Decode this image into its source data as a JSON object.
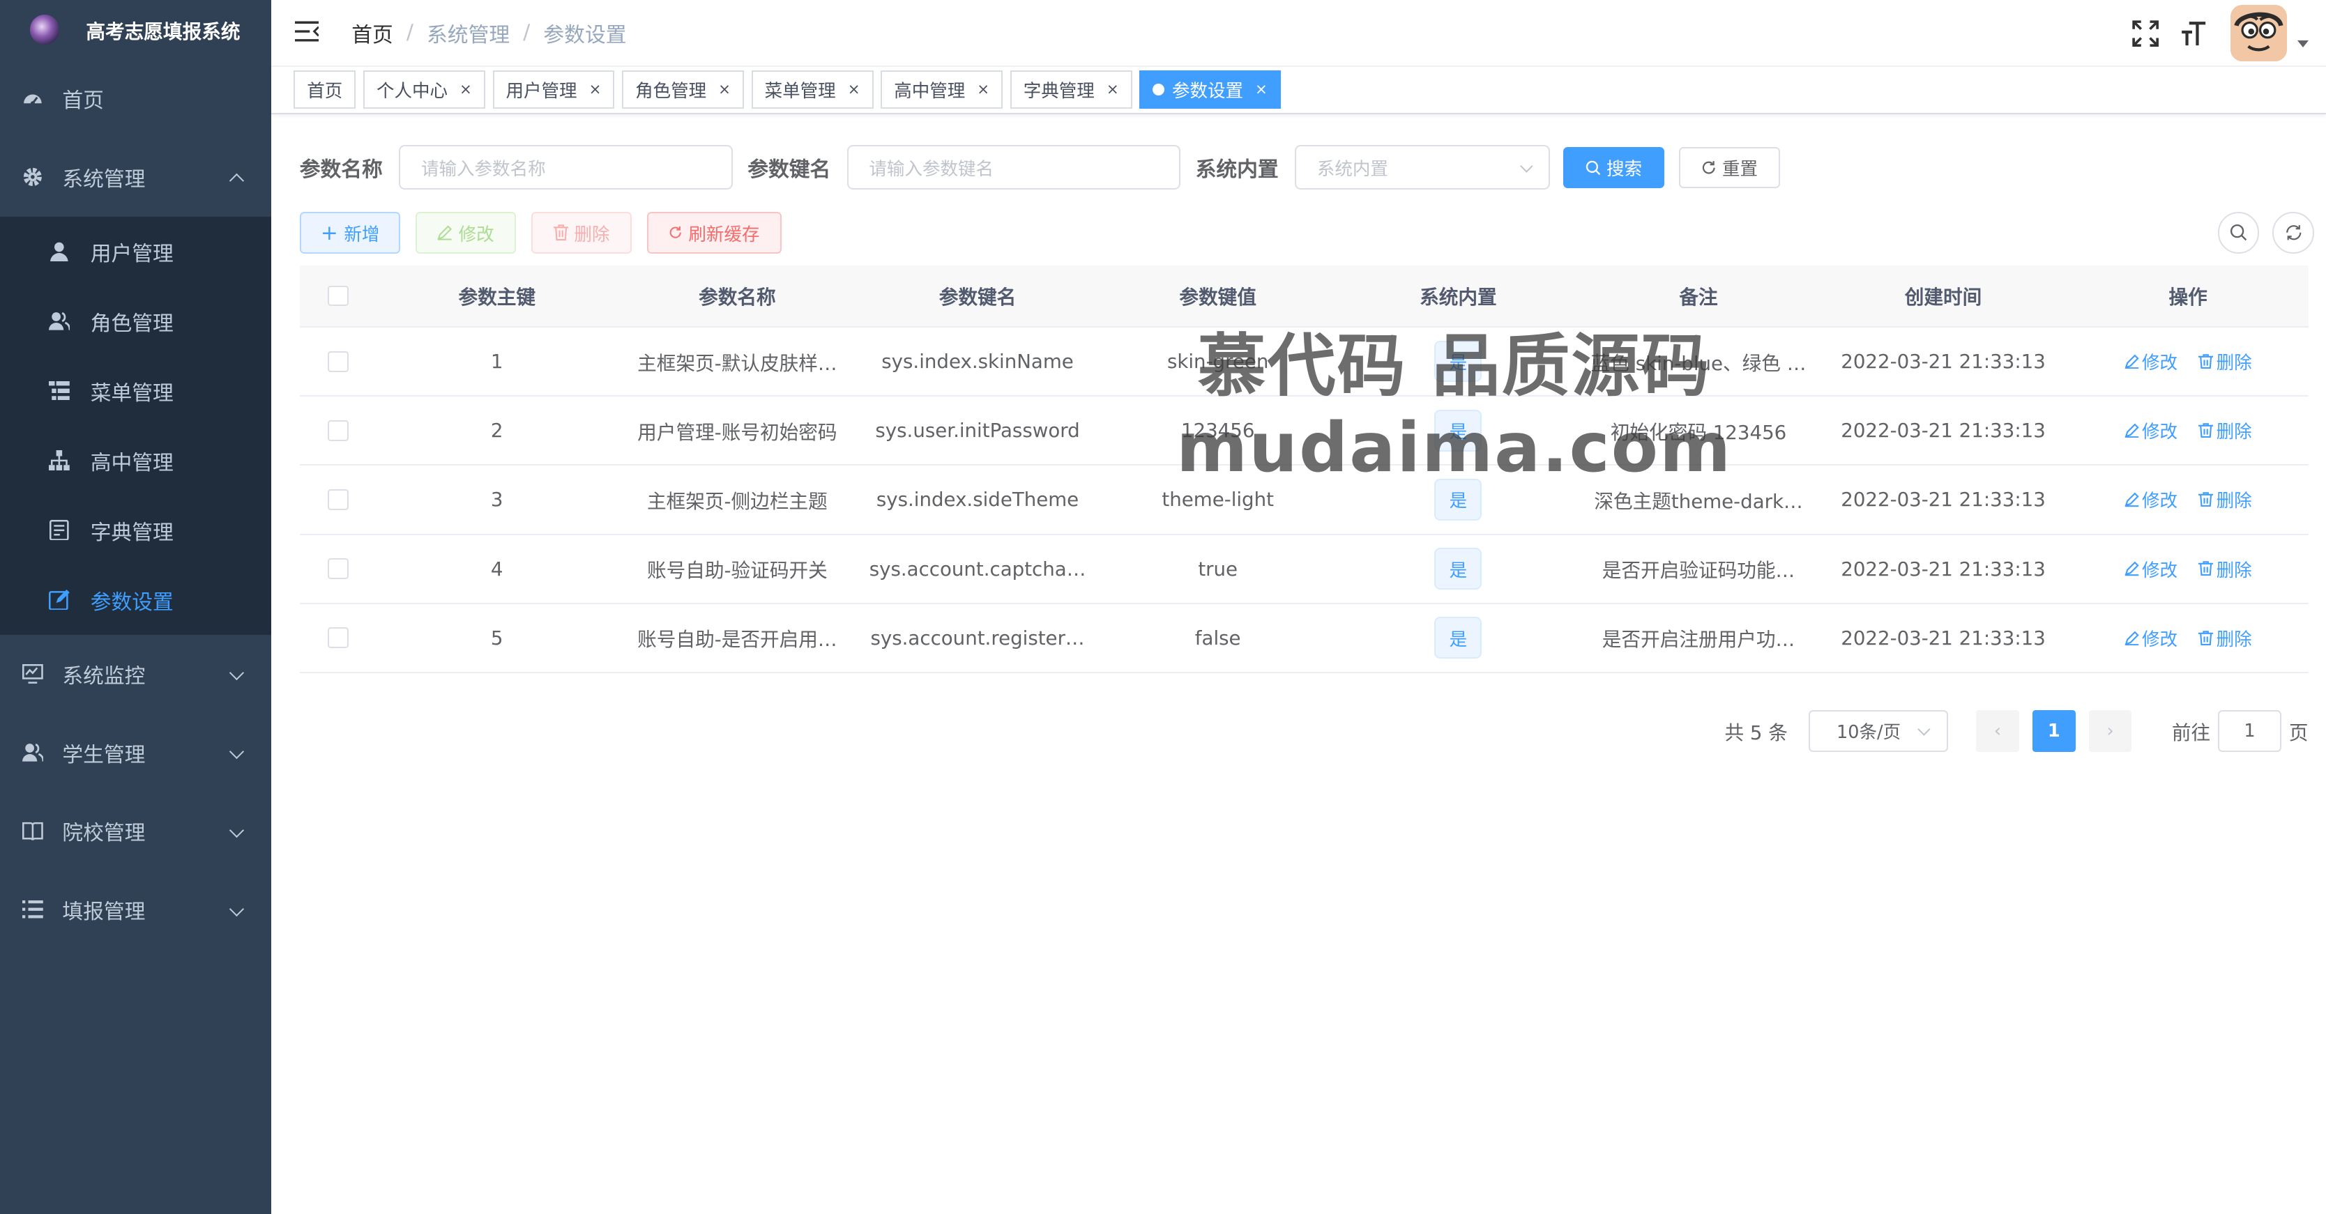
{
  "app": {
    "title": "高考志愿填报系统"
  },
  "sidebar": {
    "items": [
      {
        "label": "首页",
        "icon": "dashboard-icon"
      },
      {
        "label": "系统管理",
        "icon": "gear-icon",
        "expanded": true,
        "children": [
          {
            "label": "用户管理",
            "icon": "user-icon"
          },
          {
            "label": "角色管理",
            "icon": "peoples-icon"
          },
          {
            "label": "菜单管理",
            "icon": "tree-table-icon"
          },
          {
            "label": "高中管理",
            "icon": "tree-icon"
          },
          {
            "label": "字典管理",
            "icon": "dict-icon"
          },
          {
            "label": "参数设置",
            "icon": "edit-icon",
            "active": true
          }
        ]
      },
      {
        "label": "系统监控",
        "icon": "monitor-icon"
      },
      {
        "label": "学生管理",
        "icon": "peoples-icon"
      },
      {
        "label": "院校管理",
        "icon": "book-icon"
      },
      {
        "label": "填报管理",
        "icon": "list-icon"
      }
    ]
  },
  "breadcrumb": [
    "首页",
    "系统管理",
    "参数设置"
  ],
  "tags": [
    {
      "label": "首页",
      "closable": false
    },
    {
      "label": "个人中心",
      "closable": true
    },
    {
      "label": "用户管理",
      "closable": true
    },
    {
      "label": "角色管理",
      "closable": true
    },
    {
      "label": "菜单管理",
      "closable": true
    },
    {
      "label": "高中管理",
      "closable": true
    },
    {
      "label": "字典管理",
      "closable": true
    },
    {
      "label": "参数设置",
      "closable": true,
      "active": true
    }
  ],
  "search": {
    "name_label": "参数名称",
    "name_placeholder": "请输入参数名称",
    "key_label": "参数键名",
    "key_placeholder": "请输入参数键名",
    "type_label": "系统内置",
    "type_placeholder": "系统内置",
    "search_btn": "搜索",
    "reset_btn": "重置"
  },
  "toolbar": {
    "add": "新增",
    "edit": "修改",
    "delete": "删除",
    "refresh": "刷新缓存"
  },
  "table": {
    "columns": [
      "参数主键",
      "参数名称",
      "参数键名",
      "参数键值",
      "系统内置",
      "备注",
      "创建时间",
      "操作"
    ],
    "rows": [
      {
        "id": "1",
        "name": "主框架页-默认皮肤样…",
        "key": "sys.index.skinName",
        "value": "skin-green",
        "type": "是",
        "remark": "蓝色 skin-blue、绿色 …",
        "time": "2022-03-21 21:33:13"
      },
      {
        "id": "2",
        "name": "用户管理-账号初始密码",
        "key": "sys.user.initPassword",
        "value": "123456",
        "type": "是",
        "remark": "初始化密码 123456",
        "time": "2022-03-21 21:33:13"
      },
      {
        "id": "3",
        "name": "主框架页-侧边栏主题",
        "key": "sys.index.sideTheme",
        "value": "theme-light",
        "type": "是",
        "remark": "深色主题theme-dark…",
        "time": "2022-03-21 21:33:13"
      },
      {
        "id": "4",
        "name": "账号自助-验证码开关",
        "key": "sys.account.captcha…",
        "value": "true",
        "type": "是",
        "remark": "是否开启验证码功能…",
        "time": "2022-03-21 21:33:13"
      },
      {
        "id": "5",
        "name": "账号自助-是否开启用…",
        "key": "sys.account.register…",
        "value": "false",
        "type": "是",
        "remark": "是否开启注册用户功…",
        "time": "2022-03-21 21:33:13"
      }
    ],
    "op_edit": "修改",
    "op_delete": "删除"
  },
  "pagination": {
    "total_text": "共 5 条",
    "page_size": "10条/页",
    "current": "1",
    "goto_label": "前往",
    "goto_value": "1",
    "page_unit": "页"
  },
  "watermark": {
    "line1": "慕代码 品质源码",
    "line2": "mudaima.com"
  },
  "colors": {
    "sidebar_bg": "#304156",
    "submenu_bg": "#1f2d3d",
    "primary": "#409eff",
    "danger": "#f56c6c",
    "success": "#67c23a"
  }
}
